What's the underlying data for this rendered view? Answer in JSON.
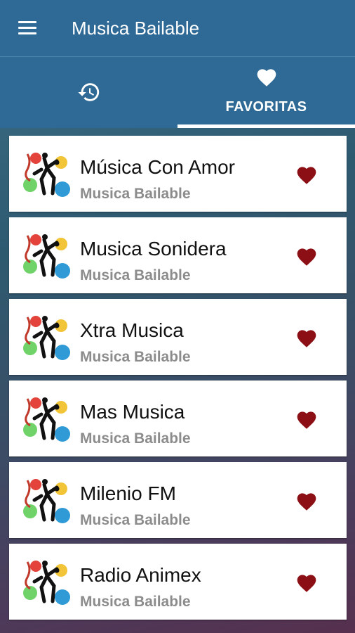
{
  "appbar": {
    "title": "Musica Bailable",
    "menu_icon": "hamburger-menu-icon"
  },
  "tabs": [
    {
      "name": "history",
      "icon": "history-icon",
      "label": "",
      "selected": false
    },
    {
      "name": "favorites",
      "icon": "heart-icon",
      "label": "FAVORITAS",
      "selected": true
    }
  ],
  "colors": {
    "appbar": "#2f6a96",
    "heart": "#8b0f14",
    "subtitle": "#8c8c8c"
  },
  "stations": [
    {
      "name": "Música Con Amor",
      "subtitle": "Musica Bailable",
      "favorite": true
    },
    {
      "name": "Musica Sonidera",
      "subtitle": "Musica Bailable",
      "favorite": true
    },
    {
      "name": "Xtra Musica",
      "subtitle": "Musica Bailable",
      "favorite": true
    },
    {
      "name": "Mas Musica",
      "subtitle": "Musica Bailable",
      "favorite": true
    },
    {
      "name": "Milenio FM",
      "subtitle": "Musica Bailable",
      "favorite": true
    },
    {
      "name": "Radio Animex",
      "subtitle": "Musica Bailable",
      "favorite": true
    }
  ]
}
